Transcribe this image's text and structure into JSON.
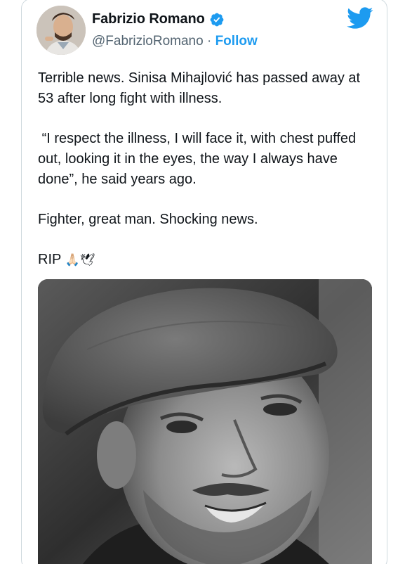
{
  "tweet": {
    "author": {
      "display_name": "Fabrizio Romano",
      "handle": "@FabrizioRomano",
      "separator": "·",
      "follow_label": "Follow",
      "verified": true,
      "avatar_icon": "profile-photo"
    },
    "brand": {
      "icon": "twitter-bird-icon",
      "color": "#1d9bf0"
    },
    "paragraphs": [
      "Terrible news. Sinisa Mihajlović has passed away at 53 after long fight with illness.",
      " “I respect the illness, I will face it, with chest puffed out, looking it in the eyes, the way I always have done”, he said years ago.",
      "Fighter, great man. Shocking news.",
      "RIP"
    ],
    "rip_emojis": "🙏🏻🕊",
    "media": {
      "type": "photo",
      "style": "black-and-white portrait of a smiling man in a flat cap"
    }
  }
}
